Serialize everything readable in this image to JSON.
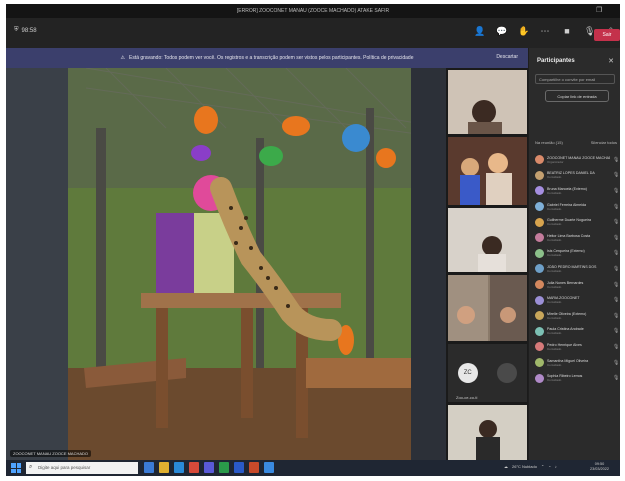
{
  "window": {
    "title": "[ERROR] ZOOCONET MANAU (ZOOCE MACHADO) ATAKE SAFIR"
  },
  "toolbar": {
    "left_label": "98:58",
    "labels": [
      "Chat",
      "People",
      "React",
      "More"
    ],
    "leave_label": "Sair"
  },
  "notice": {
    "text": "Está gravando: Todos podem ver você. Os registros e a transcrição podem ser vistos pelos participantes. Política de privacidade",
    "dismiss": "Descartar"
  },
  "stage": {
    "name_label": "ZOOCONET MANAU ZOOCE MACHADO"
  },
  "tiles": [
    {
      "initials": "ZC",
      "label": "Zoo-ce-co-ti"
    }
  ],
  "panel": {
    "title": "Participantes",
    "invite_placeholder": "Compartilhe o convite por email",
    "copy_label": "Copiar link de entrada",
    "section_label": "Na reunião (15)",
    "mute_all": "Silenciar todos"
  },
  "participants": [
    {
      "name": "ZOOCONET MANAU ZOOCE MACHADO",
      "role": "Organizador",
      "color": "#d98a6a"
    },
    {
      "name": "BEATRIZ LOPES DANIEL DA",
      "role": "Convidado",
      "color": "#c4a070"
    },
    {
      "name": "Bruna Manoela (Extemo)",
      "role": "Convidado",
      "color": "#a58ee0"
    },
    {
      "name": "Gabriel Ferreira Almeida",
      "role": "Convidado",
      "color": "#7fb0d8"
    },
    {
      "name": "Guilherme Duarte Nogueira",
      "role": "Convidado",
      "color": "#d8a44e"
    },
    {
      "name": "Heitor Lima Barbosa Costa",
      "role": "Convidado",
      "color": "#c47c9c"
    },
    {
      "name": "Isis Cerqueira (Extemo)",
      "role": "Convidado",
      "color": "#8cc08a"
    },
    {
      "name": "JOÃO PEDRO MARTINS DOS",
      "role": "Convidado",
      "color": "#6ea0c8"
    },
    {
      "name": "Julia Nunes Bernardes",
      "role": "Convidado",
      "color": "#d4885e"
    },
    {
      "name": "MARIA ZOOCONET",
      "role": "Convidado",
      "color": "#9b8fd6"
    },
    {
      "name": "Mirelle Oliveira (Extemo)",
      "role": "Convidado",
      "color": "#c8a65a"
    },
    {
      "name": "Paula Cristina Andrade",
      "role": "Convidado",
      "color": "#7cc0b4"
    },
    {
      "name": "Pedro Henrique Alves",
      "role": "Convidado",
      "color": "#d67a7a"
    },
    {
      "name": "Samantha Miguel Oliveira",
      "role": "Convidado",
      "color": "#a0b86a"
    },
    {
      "name": "Sophia Ribeiro Lemos",
      "role": "Convidado",
      "color": "#b08ac8"
    }
  ],
  "taskbar": {
    "search_placeholder": "Digite aqui para pesquisar",
    "tray_temp": "26°C Nublado",
    "time": "09:50",
    "date": "23/03/2022"
  },
  "colors": {
    "accent": "#3b3f6c",
    "leave": "#c4314b",
    "taskbar": "#1f2633"
  }
}
